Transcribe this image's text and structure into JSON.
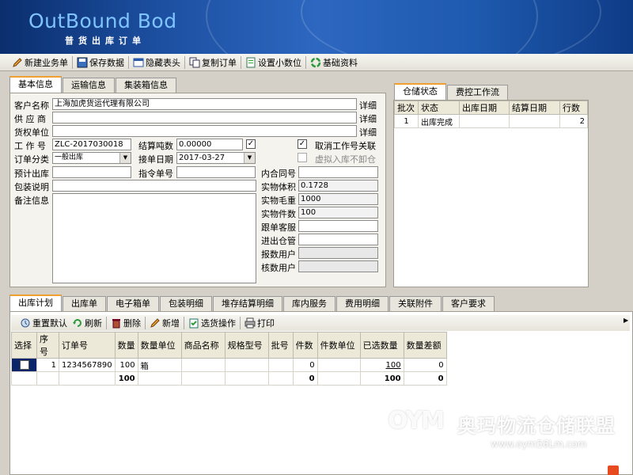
{
  "banner": {
    "title": "OutBound Bod",
    "subtitle": "普货出库订单"
  },
  "toolbar": {
    "new": "新建业务单",
    "save": "保存数据",
    "hide": "隐藏表头",
    "copy": "复制订单",
    "decimals": "设置小数位",
    "basic": "基础资料"
  },
  "main_tabs": [
    "基本信息",
    "运输信息",
    "集装箱信息"
  ],
  "form": {
    "customer_label": "客户名称",
    "customer_value": "上海加虎货运代理有限公司",
    "customer_link": "详细",
    "supplier_label": "供 应 商",
    "supplier_value": "",
    "supplier_link": "详细",
    "owner_label": "货权单位",
    "owner_value": "",
    "owner_link": "详细",
    "job_label": "工 作 号",
    "job_value": "ZLC-2017030018",
    "tons_label": "结算吨数",
    "tons_value": "0.00000",
    "cancel_label": "取消工作号关联",
    "order_type_label": "订单分类",
    "order_type_value": "一般出库",
    "date_label": "接单日期",
    "date_value": "2017-03-27",
    "virtual_label": "虚拟入库不卸仓",
    "plan_out_label": "预计出库",
    "plan_out_value": "",
    "cmd_label": "指令单号",
    "cmd_value": "",
    "contract_label": "内合同号",
    "contract_value": "",
    "pack_label": "包装说明",
    "pack_value": "",
    "volume_label": "实物体积",
    "volume_value": "0.1728",
    "remark_label": "备注信息",
    "weight_label": "实物毛重",
    "weight_value": "1000",
    "pieces_label": "实物件数",
    "pieces_value": "100",
    "cs_label": "跟单客服",
    "cs_value": "",
    "wh_label": "进出仓管",
    "wh_value": "",
    "report_label": "报数用户",
    "report_value": "",
    "check_label": "核数用户",
    "check_value": ""
  },
  "side_tabs": [
    "仓储状态",
    "费控工作流"
  ],
  "status_table": {
    "headers": [
      "批次",
      "状态",
      "出库日期",
      "结算日期",
      "行数"
    ],
    "rows": [
      [
        "1",
        "出库完成",
        "",
        "",
        "2"
      ]
    ]
  },
  "bottom_tabs": [
    "出库计划",
    "出库单",
    "电子箱单",
    "包装明细",
    "堆存结算明细",
    "库内服务",
    "费用明细",
    "关联附件",
    "客户要求"
  ],
  "bottom_toolbar": {
    "reset": "重置默认",
    "refresh": "刷新",
    "delete": "删除",
    "add": "新增",
    "pick": "选货操作",
    "print": "打印"
  },
  "plan_table": {
    "headers": [
      "选择",
      "序号",
      "订单号",
      "数量",
      "数量单位",
      "商品名称",
      "规格型号",
      "批号",
      "件数",
      "件数单位",
      "已选数量",
      "数量差额"
    ],
    "rows": [
      [
        "",
        "1",
        "1234567890",
        "100",
        "箱",
        "",
        "",
        "",
        "0",
        "",
        "100",
        "0"
      ]
    ],
    "totals": [
      "",
      "",
      "",
      "100",
      "",
      "",
      "",
      "",
      "0",
      "",
      "100",
      "0"
    ]
  },
  "watermark": {
    "logo": "OYM",
    "text": "奥玛物流仓储联盟",
    "url": "www.oym56Lm.com"
  },
  "colors": {
    "banner": "#1c4fa0",
    "tab_accent": "#f0a030",
    "selected_row": "#0a246a"
  }
}
